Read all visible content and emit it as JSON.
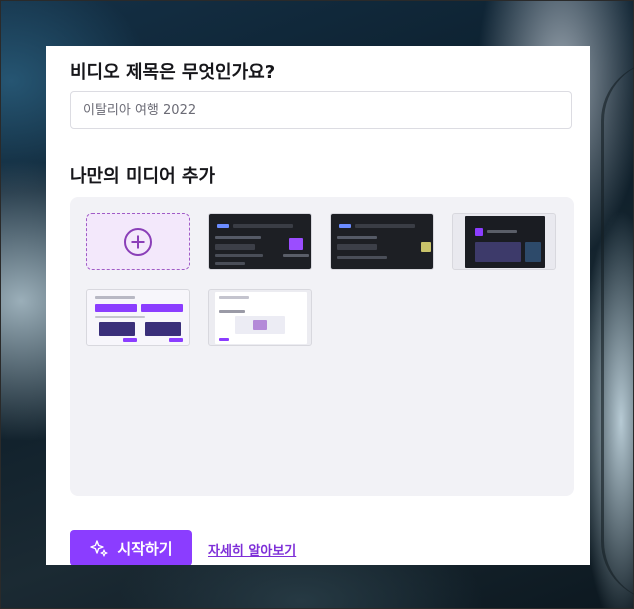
{
  "form": {
    "title": "비디오 제목은 무엇인가요?",
    "title_input_placeholder": "이탈리아 여행 2022"
  },
  "media": {
    "heading": "나만의 미디어 추가",
    "add_icon": "plus-circle-icon",
    "thumbnails": [
      {
        "name": "screenshot-thumbnail-1"
      },
      {
        "name": "screenshot-thumbnail-2"
      },
      {
        "name": "screenshot-thumbnail-3"
      },
      {
        "name": "screenshot-thumbnail-4"
      },
      {
        "name": "screenshot-thumbnail-5"
      }
    ]
  },
  "actions": {
    "start_label": "시작하기",
    "start_icon": "sparkle-icon",
    "learn_more_label": "자세히 알아보기"
  },
  "colors": {
    "accent": "#8b3dff",
    "link": "#7e2fd8",
    "add_tile_border": "#a15bc7",
    "add_tile_bg": "#f3e8fb",
    "media_area_bg": "#f2f2f6"
  }
}
